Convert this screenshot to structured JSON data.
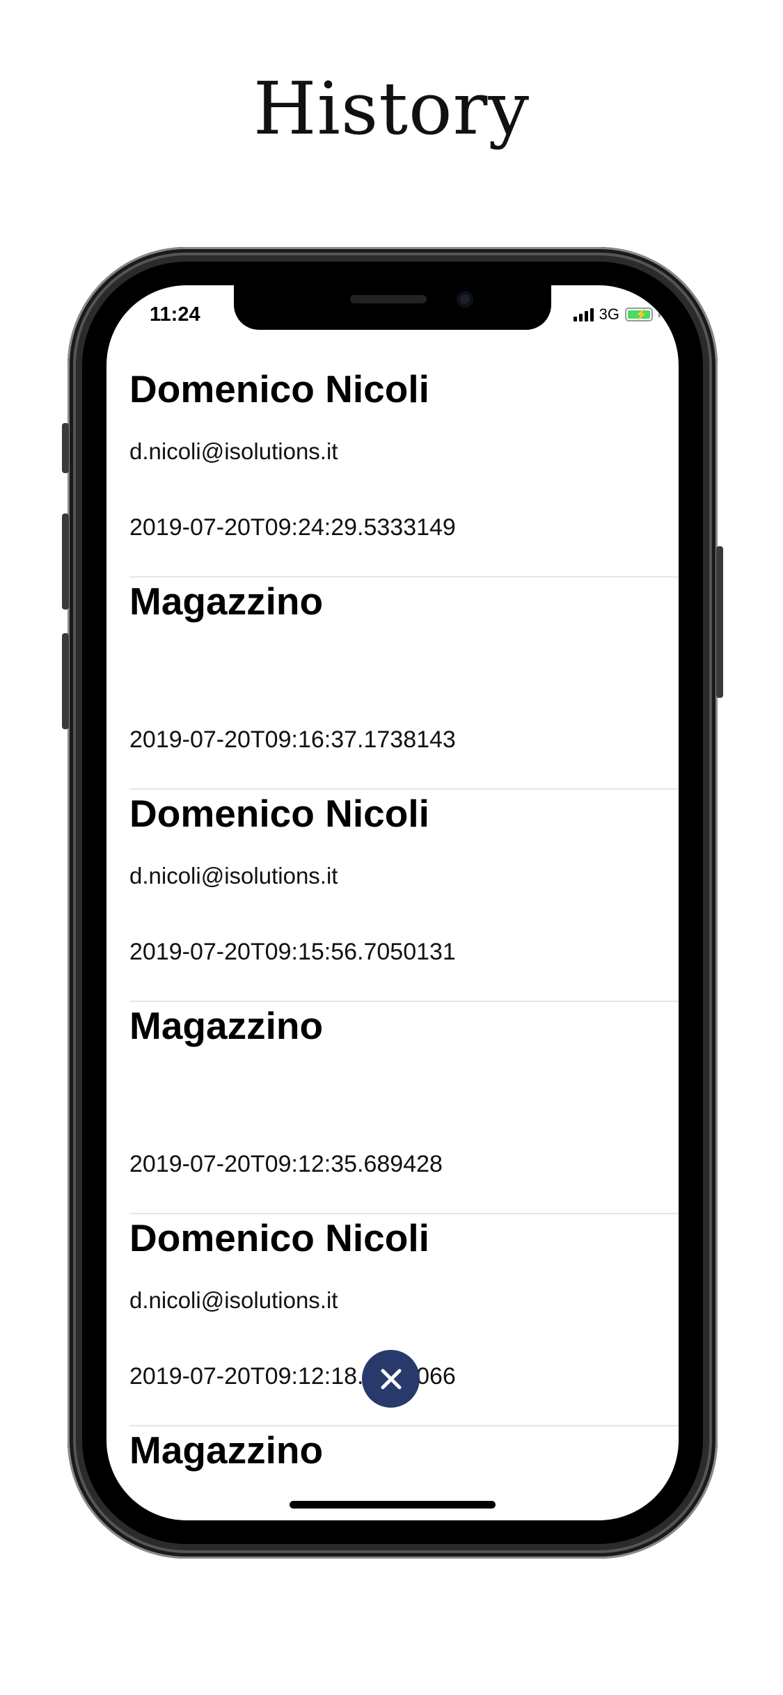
{
  "page_title": "History",
  "status_bar": {
    "time": "11:24",
    "network": "3G"
  },
  "entries": [
    {
      "name": "Domenico Nicoli",
      "email": "d.nicoli@isolutions.it",
      "timestamp": "2019-07-20T09:24:29.5333149"
    },
    {
      "name": "Magazzino",
      "email": "",
      "timestamp": "2019-07-20T09:16:37.1738143"
    },
    {
      "name": "Domenico Nicoli",
      "email": "d.nicoli@isolutions.it",
      "timestamp": "2019-07-20T09:15:56.7050131"
    },
    {
      "name": "Magazzino",
      "email": "",
      "timestamp": "2019-07-20T09:12:35.689428"
    },
    {
      "name": "Domenico Nicoli",
      "email": "d.nicoli@isolutions.it",
      "timestamp": "2019-07-20T09:12:18.8088066"
    },
    {
      "name": "Magazzino",
      "email": "",
      "timestamp": ""
    }
  ],
  "icons": {
    "close": "close-icon",
    "signal": "signal-icon",
    "battery": "battery-icon"
  },
  "colors": {
    "close_button": "#283a6c",
    "battery_fill": "#4cd964"
  }
}
